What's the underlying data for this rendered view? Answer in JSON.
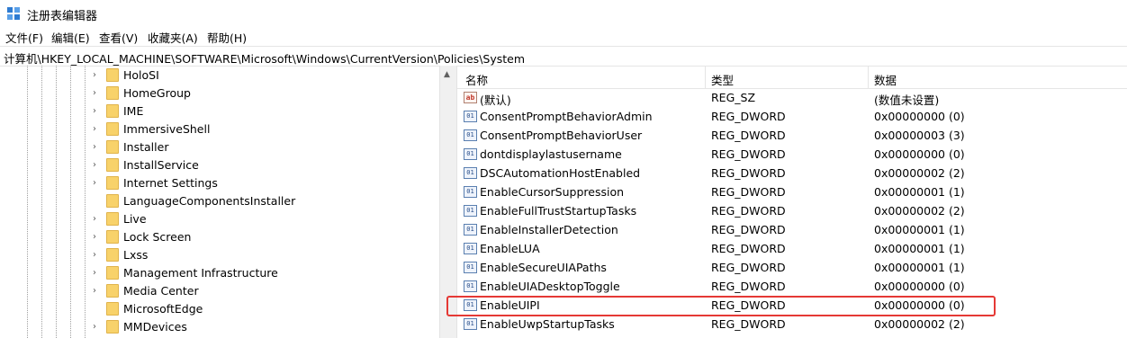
{
  "window": {
    "title": "注册表编辑器",
    "app_icon": "regedit-icon"
  },
  "menu": [
    "文件(F)",
    "编辑(E)",
    "查看(V)",
    "收藏夹(A)",
    "帮助(H)"
  ],
  "address": "计算机\\HKEY_LOCAL_MACHINE\\SOFTWARE\\Microsoft\\Windows\\CurrentVersion\\Policies\\System",
  "tree": [
    {
      "label": "HoloSI",
      "expandable": true
    },
    {
      "label": "HomeGroup",
      "expandable": true
    },
    {
      "label": "IME",
      "expandable": true
    },
    {
      "label": "ImmersiveShell",
      "expandable": true
    },
    {
      "label": "Installer",
      "expandable": true
    },
    {
      "label": "InstallService",
      "expandable": true
    },
    {
      "label": "Internet Settings",
      "expandable": true
    },
    {
      "label": "LanguageComponentsInstaller",
      "expandable": false
    },
    {
      "label": "Live",
      "expandable": true
    },
    {
      "label": "Lock Screen",
      "expandable": true
    },
    {
      "label": "Lxss",
      "expandable": true
    },
    {
      "label": "Management Infrastructure",
      "expandable": true
    },
    {
      "label": "Media Center",
      "expandable": true
    },
    {
      "label": "MicrosoftEdge",
      "expandable": false
    },
    {
      "label": "MMDevices",
      "expandable": true
    }
  ],
  "columns": {
    "name": "名称",
    "type": "类型",
    "data": "数据"
  },
  "values": [
    {
      "name": "(默认)",
      "type": "REG_SZ",
      "data": "(数值未设置)",
      "icon": "string-value-icon",
      "icon_text": "ab"
    },
    {
      "name": "ConsentPromptBehaviorAdmin",
      "type": "REG_DWORD",
      "data": "0x00000000 (0)",
      "icon": "dword-value-icon",
      "icon_text": "01"
    },
    {
      "name": "ConsentPromptBehaviorUser",
      "type": "REG_DWORD",
      "data": "0x00000003 (3)",
      "icon": "dword-value-icon",
      "icon_text": "01"
    },
    {
      "name": "dontdisplaylastusername",
      "type": "REG_DWORD",
      "data": "0x00000000 (0)",
      "icon": "dword-value-icon",
      "icon_text": "01"
    },
    {
      "name": "DSCAutomationHostEnabled",
      "type": "REG_DWORD",
      "data": "0x00000002 (2)",
      "icon": "dword-value-icon",
      "icon_text": "01"
    },
    {
      "name": "EnableCursorSuppression",
      "type": "REG_DWORD",
      "data": "0x00000001 (1)",
      "icon": "dword-value-icon",
      "icon_text": "01"
    },
    {
      "name": "EnableFullTrustStartupTasks",
      "type": "REG_DWORD",
      "data": "0x00000002 (2)",
      "icon": "dword-value-icon",
      "icon_text": "01"
    },
    {
      "name": "EnableInstallerDetection",
      "type": "REG_DWORD",
      "data": "0x00000001 (1)",
      "icon": "dword-value-icon",
      "icon_text": "01"
    },
    {
      "name": "EnableLUA",
      "type": "REG_DWORD",
      "data": "0x00000001 (1)",
      "icon": "dword-value-icon",
      "icon_text": "01"
    },
    {
      "name": "EnableSecureUIAPaths",
      "type": "REG_DWORD",
      "data": "0x00000001 (1)",
      "icon": "dword-value-icon",
      "icon_text": "01"
    },
    {
      "name": "EnableUIADesktopToggle",
      "type": "REG_DWORD",
      "data": "0x00000000 (0)",
      "icon": "dword-value-icon",
      "icon_text": "01"
    },
    {
      "name": "EnableUIPI",
      "type": "REG_DWORD",
      "data": "0x00000000 (0)",
      "icon": "dword-value-icon",
      "icon_text": "01",
      "highlighted": true
    },
    {
      "name": "EnableUwpStartupTasks",
      "type": "REG_DWORD",
      "data": "0x00000002 (2)",
      "icon": "dword-value-icon",
      "icon_text": "01"
    }
  ],
  "colors": {
    "highlight": "#e53935",
    "folder": "#f8d26a"
  }
}
